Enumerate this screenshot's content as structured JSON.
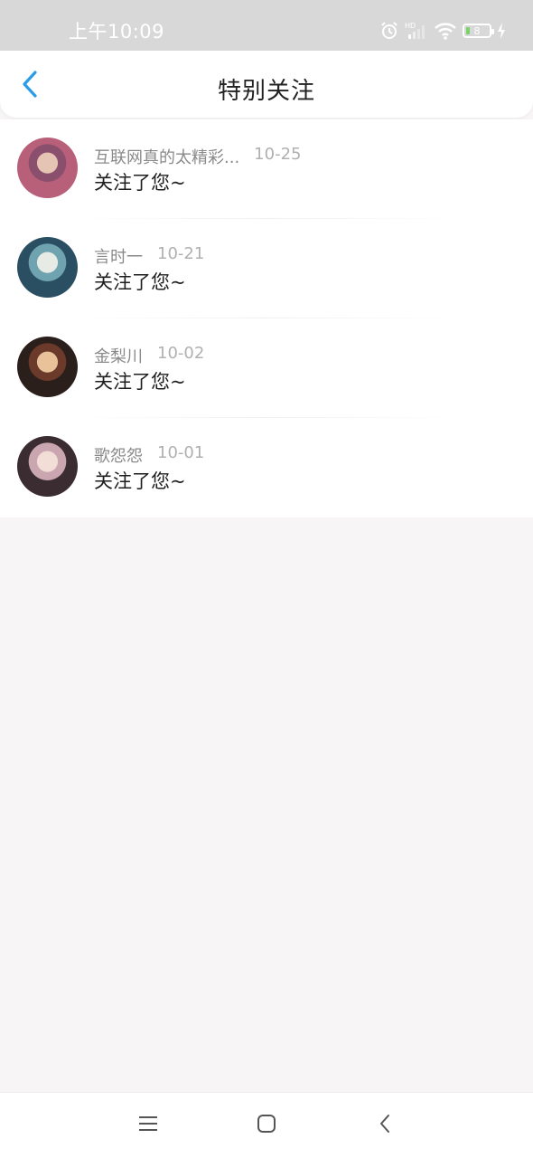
{
  "status_bar": {
    "time": "上午10:09",
    "battery_level": "8"
  },
  "header": {
    "title": "特别关注"
  },
  "list": [
    {
      "name": "互联网真的太精彩...",
      "date": "10-25",
      "message": "关注了您~",
      "avatar_colors": [
        "#b8607a",
        "#e6c4b3",
        "#8a4f6c"
      ]
    },
    {
      "name": "言时一",
      "date": "10-21",
      "message": "关注了您~",
      "avatar_colors": [
        "#2a4f62",
        "#e7ebe6",
        "#70a3b0"
      ]
    },
    {
      "name": "金梨川",
      "date": "10-02",
      "message": "关注了您~",
      "avatar_colors": [
        "#2b1f1b",
        "#e8c39a",
        "#6c3a2a"
      ]
    },
    {
      "name": "歌怨怨",
      "date": "10-01",
      "message": "关注了您~",
      "avatar_colors": [
        "#3a2c30",
        "#f2ded6",
        "#c9a6b0"
      ]
    }
  ],
  "colors": {
    "accent": "#2a9be8",
    "page_bg": "#f7f5f6",
    "status_bar_bg": "#d8d8d8"
  }
}
